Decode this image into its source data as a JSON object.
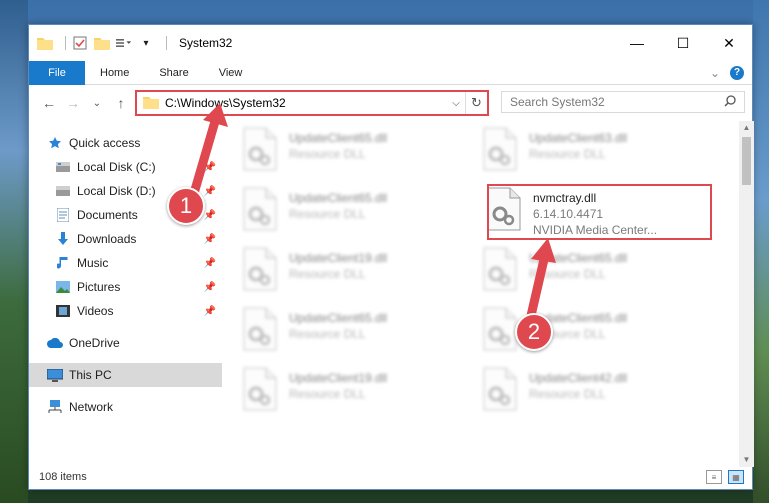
{
  "window": {
    "title": "System32",
    "controls": {
      "minimize": "—",
      "maximize": "☐",
      "close": "✕"
    }
  },
  "ribbon": {
    "tabs": [
      "File",
      "Home",
      "Share",
      "View"
    ],
    "expand_icon": "chevron-down-icon",
    "help": "?"
  },
  "nav": {
    "back": "←",
    "forward": "→",
    "recent": "⌄",
    "up": "↑",
    "address": "C:\\Windows\\System32",
    "refresh": "↻",
    "search_placeholder": "Search System32"
  },
  "sidebar": {
    "items": [
      {
        "label": "Quick access",
        "icon": "star-icon",
        "pinned": false
      },
      {
        "label": "Local Disk (C:)",
        "icon": "disk-icon",
        "pinned": true
      },
      {
        "label": "Local Disk (D:)",
        "icon": "disk-icon",
        "pinned": true
      },
      {
        "label": "Documents",
        "icon": "documents-icon",
        "pinned": true
      },
      {
        "label": "Downloads",
        "icon": "downloads-icon",
        "pinned": true
      },
      {
        "label": "Music",
        "icon": "music-icon",
        "pinned": true
      },
      {
        "label": "Pictures",
        "icon": "pictures-icon",
        "pinned": true
      },
      {
        "label": "Videos",
        "icon": "videos-icon",
        "pinned": true
      },
      {
        "label": "OneDrive",
        "icon": "cloud-icon",
        "pinned": false
      },
      {
        "label": "This PC",
        "icon": "computer-icon",
        "pinned": false,
        "selected": true
      },
      {
        "label": "Network",
        "icon": "network-icon",
        "pinned": false
      }
    ]
  },
  "files": [
    {
      "name": "UpdateClient65.dll",
      "sub": "Resource DLL",
      "col": 0,
      "row": 0
    },
    {
      "name": "UpdateClient63.dll",
      "sub": "Resource DLL",
      "col": 1,
      "row": 0
    },
    {
      "name": "UpdateClient65.dll",
      "sub": "Resource DLL",
      "col": 0,
      "row": 1
    },
    {
      "name": "nvmctray.dll",
      "sub": "6.14.10.4471",
      "sub2": "NVIDIA Media Center...",
      "col": 1,
      "row": 1,
      "highlighted": true
    },
    {
      "name": "UpdateClient19.dll",
      "sub": "Resource DLL",
      "col": 0,
      "row": 2
    },
    {
      "name": "UpdateClient65.dll",
      "sub": "Resource DLL",
      "col": 1,
      "row": 2
    },
    {
      "name": "UpdateClient65.dll",
      "sub": "Resource DLL",
      "col": 0,
      "row": 3
    },
    {
      "name": "UpdateClient65.dll",
      "sub": "Resource DLL",
      "col": 1,
      "row": 3
    },
    {
      "name": "UpdateClient19.dll",
      "sub": "Resource DLL",
      "col": 0,
      "row": 4
    },
    {
      "name": "UpdateClient42.dll",
      "sub": "Resource DLL",
      "col": 1,
      "row": 4
    }
  ],
  "status": {
    "count": "108 items"
  },
  "annotations": {
    "one": "1",
    "two": "2"
  },
  "colors": {
    "accent": "#1979ca",
    "annotation": "#e0484f"
  }
}
